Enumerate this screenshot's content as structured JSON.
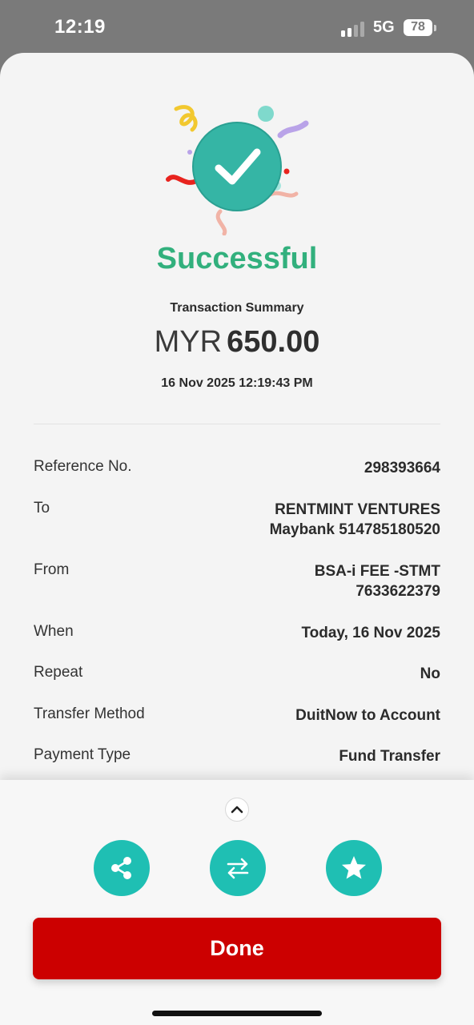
{
  "status_bar": {
    "time": "12:19",
    "network": "5G",
    "battery": "78",
    "battery_level": 0.78
  },
  "result": {
    "title": "Successful",
    "summary_label": "Transaction Summary",
    "currency": "MYR",
    "amount": "650.00",
    "datetime": "16 Nov 2025 12:19:43 PM"
  },
  "details": [
    {
      "label": "Reference No.",
      "value": [
        "298393664"
      ]
    },
    {
      "label": "To",
      "value": [
        "RENTMINT VENTURES",
        "Maybank 514785180520"
      ]
    },
    {
      "label": "From",
      "value": [
        "BSA-i FEE -STMT",
        "7633622379"
      ]
    },
    {
      "label": "When",
      "value": [
        "Today, 16 Nov 2025"
      ]
    },
    {
      "label": "Repeat",
      "value": [
        "No"
      ]
    },
    {
      "label": "Transfer Method",
      "value": [
        "DuitNow to Account"
      ]
    },
    {
      "label": "Payment Type",
      "value": [
        "Fund Transfer"
      ]
    }
  ],
  "actions": {
    "share_icon": "share-icon",
    "transfer_icon": "transfer-arrows-icon",
    "favourite_icon": "star-icon",
    "done_label": "Done"
  },
  "colors": {
    "success": "#32b07d",
    "accent": "#1fbfb3",
    "primary": "#cc0000"
  }
}
